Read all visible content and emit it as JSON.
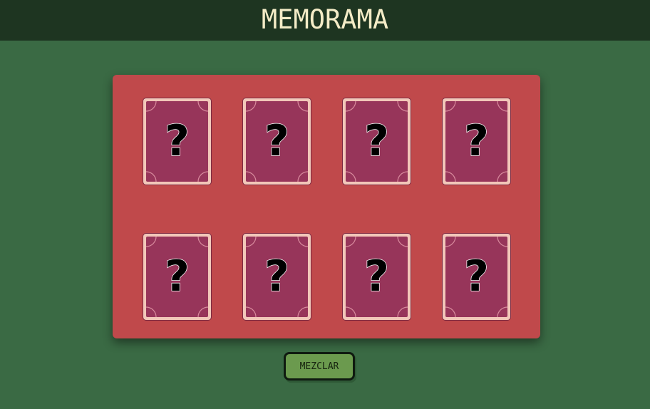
{
  "header": {
    "title": "MEMORAMA"
  },
  "board": {
    "cards": [
      {
        "face": "?",
        "state": "face-down"
      },
      {
        "face": "?",
        "state": "face-down"
      },
      {
        "face": "?",
        "state": "face-down"
      },
      {
        "face": "?",
        "state": "face-down"
      },
      {
        "face": "?",
        "state": "face-down"
      },
      {
        "face": "?",
        "state": "face-down"
      },
      {
        "face": "?",
        "state": "face-down"
      },
      {
        "face": "?",
        "state": "face-down"
      }
    ],
    "card_back_color": "#97355a",
    "card_border_color": "#f2c7b9",
    "board_color": "#c0494b"
  },
  "controls": {
    "shuffle_label": "MEZCLAR"
  },
  "colors": {
    "background": "#3a6a44",
    "header": "#1e3521",
    "title": "#f4ecc7",
    "button": "#6b9a4e"
  }
}
